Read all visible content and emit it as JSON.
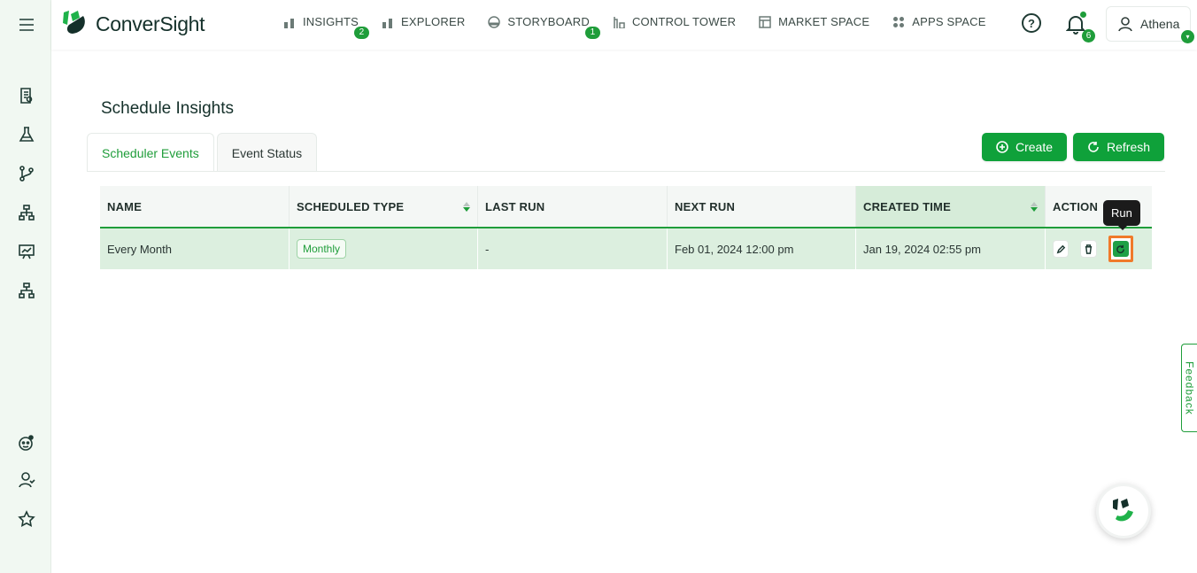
{
  "app": {
    "name": "ConverSight"
  },
  "nav": [
    {
      "label": "INSIGHTS",
      "badge": "2",
      "icon": "bar-chart-icon"
    },
    {
      "label": "EXPLORER",
      "badge": "",
      "icon": "bar-chart-icon"
    },
    {
      "label": "STORYBOARD",
      "badge": "1",
      "icon": "gauge-icon"
    },
    {
      "label": "CONTROL TOWER",
      "badge": "",
      "icon": "tower-icon"
    },
    {
      "label": "MARKET SPACE",
      "badge": "",
      "icon": "store-icon"
    },
    {
      "label": "APPS SPACE",
      "badge": "",
      "icon": "grid-icon"
    }
  ],
  "header": {
    "help": "?",
    "notifications_count": "6",
    "user_name": "Athena",
    "user_caret": "▾"
  },
  "page": {
    "title": "Schedule Insights",
    "tabs": [
      {
        "label": "Scheduler Events"
      },
      {
        "label": "Event Status"
      }
    ],
    "create_label": "Create",
    "refresh_label": "Refresh"
  },
  "table": {
    "headers": [
      "NAME",
      "SCHEDULED TYPE",
      "LAST RUN",
      "NEXT RUN",
      "CREATED TIME",
      "ACTION"
    ],
    "rows": [
      {
        "name": "Every Month",
        "type": "Monthly",
        "last_run": "-",
        "next_run": "Feb 01, 2024 12:00 pm",
        "created": "Jan 19, 2024 02:55 pm"
      }
    ]
  },
  "tooltip": "Run",
  "feedback_label": "Feedback",
  "colors": {
    "accent": "#1f9d3a",
    "highlight": "#f07a2a"
  }
}
